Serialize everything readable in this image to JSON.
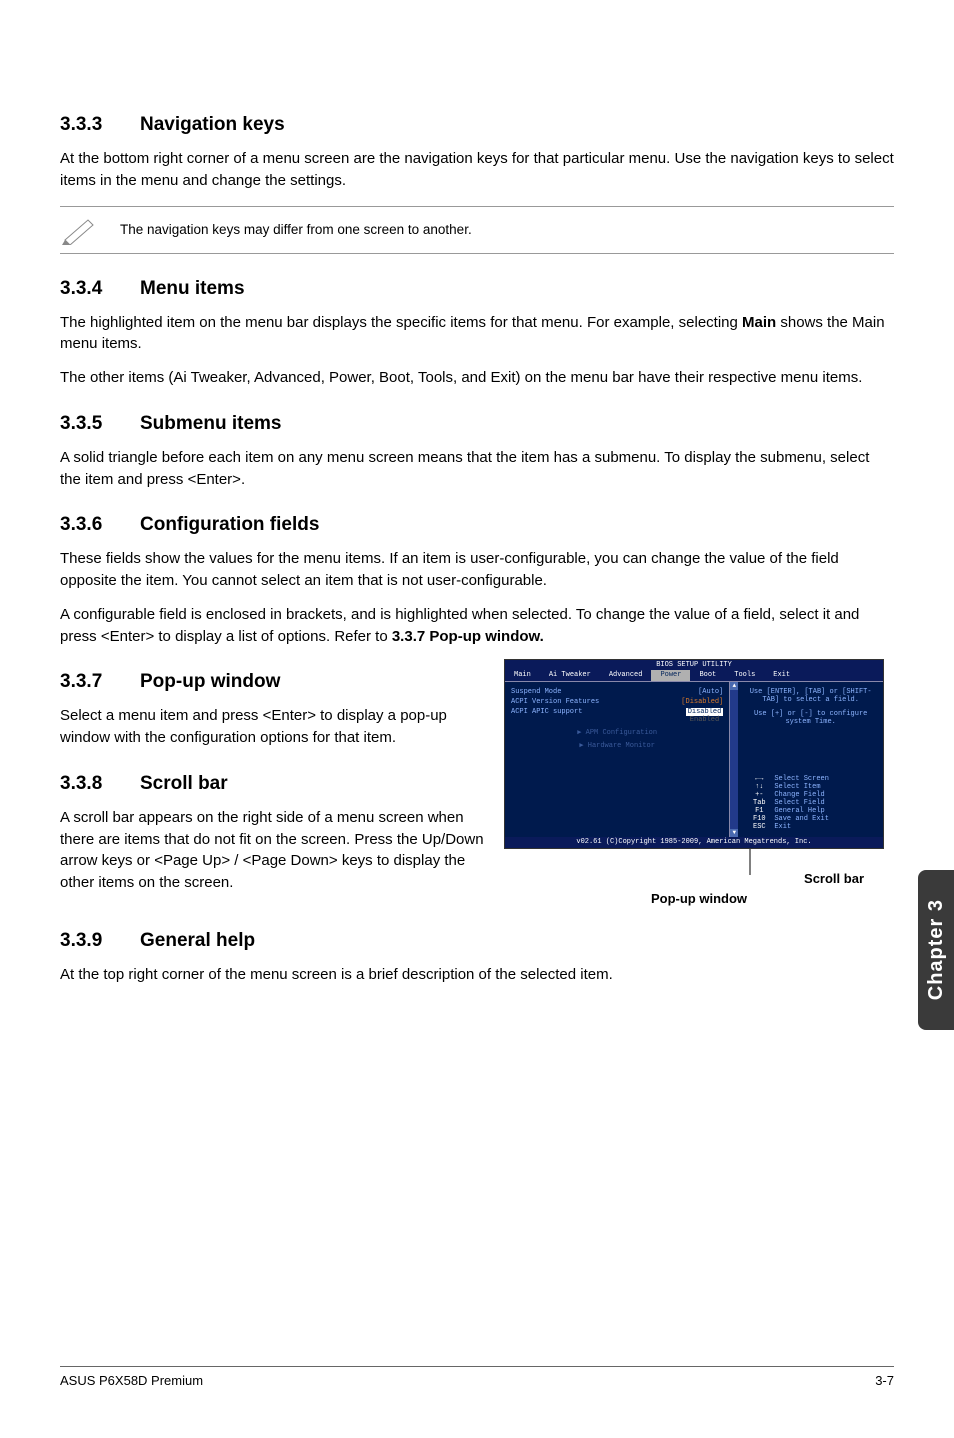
{
  "sections": {
    "s333": {
      "num": "3.3.3",
      "title": "Navigation keys",
      "p1": "At the bottom right corner of a menu screen are the navigation keys for that particular menu. Use the navigation keys to select items in the menu and change the settings."
    },
    "note_333": "The navigation keys may differ from one screen to another.",
    "s334": {
      "num": "3.3.4",
      "title": "Menu items",
      "p1_a": "The highlighted item on the menu bar displays the specific items for that menu. For example, selecting ",
      "p1_bold": "Main",
      "p1_b": " shows the Main menu items.",
      "p2": "The other items (Ai Tweaker, Advanced, Power, Boot, Tools, and Exit) on the menu bar have their respective menu items."
    },
    "s335": {
      "num": "3.3.5",
      "title": "Submenu items",
      "p1": "A solid triangle before each item on any menu screen means that the item has a submenu. To display the submenu, select the item and press <Enter>."
    },
    "s336": {
      "num": "3.3.6",
      "title": "Configuration fields",
      "p1": "These fields show the values for the menu items. If an item is user-configurable, you can change the value of the field opposite the item. You cannot select an item that is not user-configurable.",
      "p2_a": "A configurable field is enclosed in brackets, and is highlighted when selected. To change the value of a field, select it and press <Enter> to display a list of options. Refer to ",
      "p2_bold": "3.3.7 Pop-up window."
    },
    "s337": {
      "num": "3.3.7",
      "title": "Pop-up window",
      "p1": "Select a menu item and press <Enter> to display a pop-up window with the configuration options for that item."
    },
    "s338": {
      "num": "3.3.8",
      "title": "Scroll bar",
      "p1": "A scroll bar appears on the right side of a menu screen when there are items that do not fit on the screen. Press the Up/Down arrow keys or <Page Up> / <Page Down> keys to display the other items on the screen."
    },
    "s339": {
      "num": "3.3.9",
      "title": "General help",
      "p1": "At the top right corner of the menu screen is a brief description of the selected item."
    }
  },
  "bios": {
    "title": "BIOS SETUP UTILITY",
    "menubar": [
      "Main",
      "Ai Tweaker",
      "Advanced",
      "Power",
      "Boot",
      "Tools",
      "Exit"
    ],
    "active_index": 3,
    "items": {
      "suspend_mode": {
        "label": "Suspend Mode",
        "value": "[Auto]"
      },
      "acpi_version": {
        "label": "ACPI Version Features",
        "value": "[Disabled]"
      },
      "acpi_apic": {
        "label": "ACPI APIC support",
        "value_selected": "Disabled",
        "value_other": "Enabled"
      },
      "apm": "APM Configuration",
      "hw": "Hardware Monitor"
    },
    "help": {
      "line1": "Use [ENTER], [TAB] or [SHIFT-TAB] to select a field.",
      "line2": "Use [+] or [-] to configure system Time."
    },
    "keys": {
      "k1": {
        "k": "←→",
        "d": "Select Screen"
      },
      "k2": {
        "k": "↑↓",
        "d": "Select Item"
      },
      "k3": {
        "k": "+-",
        "d": "Change Field"
      },
      "k4": {
        "k": "Tab",
        "d": "Select Field"
      },
      "k5": {
        "k": "F1",
        "d": "General Help"
      },
      "k6": {
        "k": "F10",
        "d": "Save and Exit"
      },
      "k7": {
        "k": "ESC",
        "d": "Exit"
      }
    },
    "copyright": "v02.61 (C)Copyright 1985-2009, American Megatrends, Inc."
  },
  "callouts": {
    "scroll_bar": "Scroll bar",
    "popup_window": "Pop-up window"
  },
  "chapter_tab": "Chapter 3",
  "footer": {
    "left": "ASUS P6X58D Premium",
    "right": "3-7"
  }
}
